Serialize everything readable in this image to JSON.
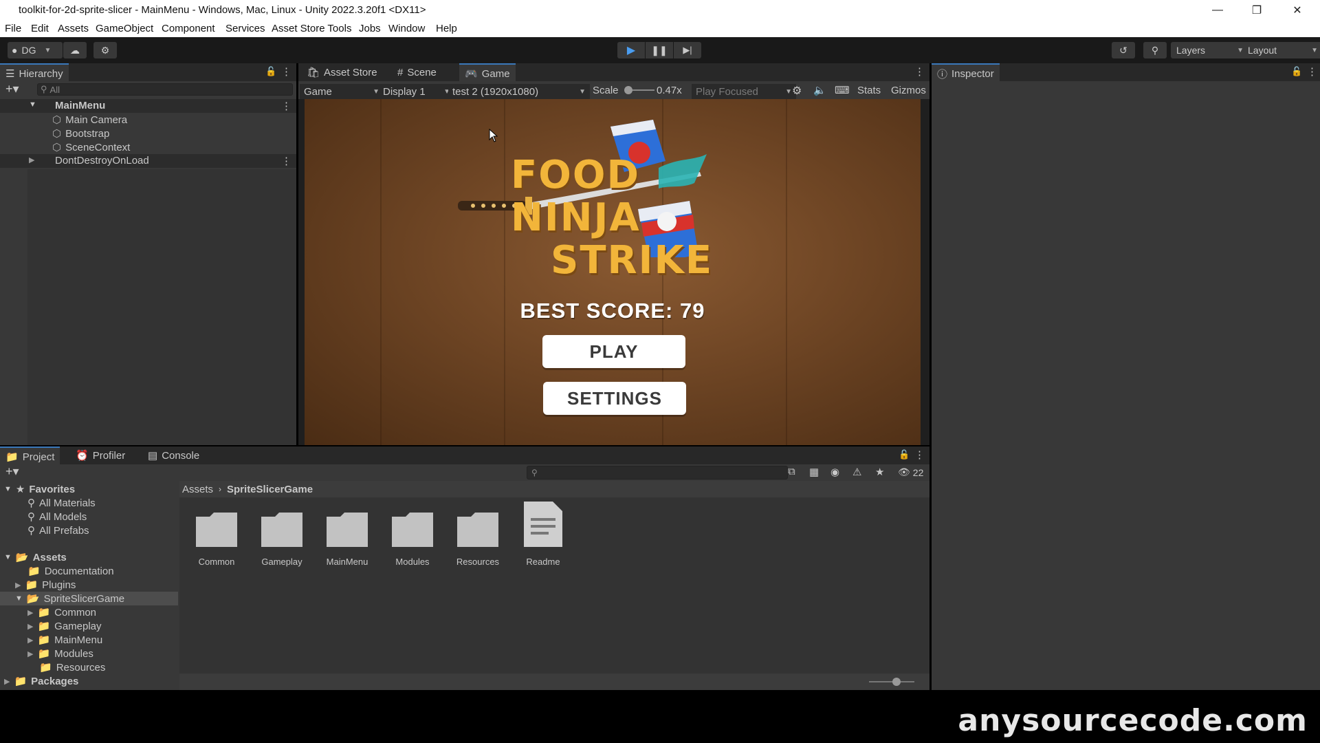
{
  "window": {
    "title": "toolkit-for-2d-sprite-slicer - MainMenu - Windows, Mac, Linux - Unity 2022.3.20f1 <DX11>"
  },
  "menu": [
    "File",
    "Edit",
    "Assets",
    "GameObject",
    "Component",
    "Services",
    "Asset Store Tools",
    "Jobs",
    "Window",
    "Help"
  ],
  "toolbar": {
    "account_label": "DG",
    "layers_label": "Layers",
    "layout_label": "Layout"
  },
  "hierarchy": {
    "tab_label": "Hierarchy",
    "search_placeholder": "All",
    "scene_name": "MainMenu",
    "items": [
      "Main Camera",
      "Bootstrap",
      "SceneContext"
    ],
    "ddol": "DontDestroyOnLoad"
  },
  "center_tabs": [
    "Asset Store",
    "Scene",
    "Game"
  ],
  "game_toolbar": {
    "view": "Game",
    "display": "Display 1",
    "resolution": "test 2 (1920x1080)",
    "scale_label": "Scale",
    "scale_value": "0.47x",
    "play_mode": "Play Focused",
    "stats": "Stats",
    "gizmos": "Gizmos"
  },
  "game": {
    "logo_line1": "FOOD NINJA",
    "logo_line2": "STRIKE",
    "best_score": "BEST SCORE: 79",
    "play_button": "PLAY",
    "settings_button": "SETTINGS"
  },
  "inspector": {
    "tab_label": "Inspector"
  },
  "bottom_tabs": [
    "Project",
    "Profiler",
    "Console"
  ],
  "project": {
    "hidden_count": "22",
    "favorites_label": "Favorites",
    "favorites": [
      "All Materials",
      "All Models",
      "All Prefabs"
    ],
    "assets_label": "Assets",
    "asset_folders": [
      "Documentation",
      "Plugins",
      "SpriteSlicerGame"
    ],
    "game_subfolders": [
      "Common",
      "Gameplay",
      "MainMenu",
      "Modules",
      "Resources"
    ],
    "packages_label": "Packages",
    "breadcrumb": [
      "Assets",
      "SpriteSlicerGame"
    ],
    "grid_items": [
      "Common",
      "Gameplay",
      "MainMenu",
      "Modules",
      "Resources",
      "Readme"
    ]
  },
  "watermark": "anysourcecode.com"
}
